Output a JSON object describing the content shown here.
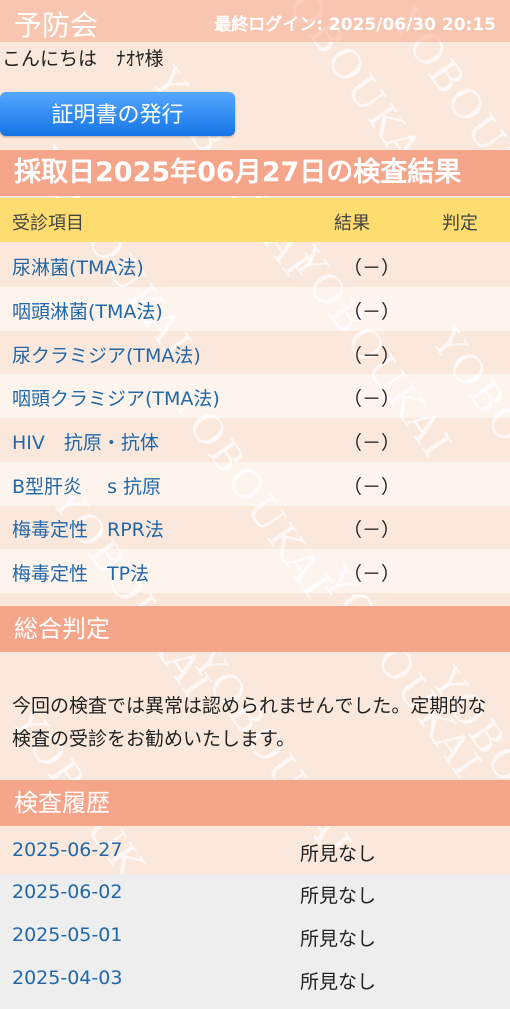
{
  "header": {
    "brand": "予防会",
    "last_login": "最終ログイン: 2025/06/30 20:15"
  },
  "greeting": "こんにちは　ﾅｵﾔ様",
  "certificate_button": "証明書の発行",
  "results": {
    "title": "採取日2025年06月27日の検査結果",
    "columns": {
      "item": "受診項目",
      "result": "結果",
      "judgment": "判定"
    },
    "rows": [
      {
        "item": "尿淋菌(TMA法)",
        "result": "（－）"
      },
      {
        "item": "咽頭淋菌(TMA法)",
        "result": "（－）"
      },
      {
        "item": "尿クラミジア(TMA法)",
        "result": "（－）"
      },
      {
        "item": "咽頭クラミジア(TMA法)",
        "result": "（－）"
      },
      {
        "item": "HIV　抗原・抗体",
        "result": "（－）"
      },
      {
        "item": "B型肝炎　 s 抗原",
        "result": "（－）"
      },
      {
        "item": "梅毒定性　RPR法",
        "result": "（－）"
      },
      {
        "item": "梅毒定性　TP法",
        "result": "（－）"
      }
    ]
  },
  "overall": {
    "heading": "総合判定",
    "text": "今回の検査では異常は認められませんでした。定期的な検査の受診をお勧めいたします。"
  },
  "history": {
    "heading": "検査履歴",
    "rows": [
      {
        "date": "2025-06-27",
        "finding": "所見なし"
      },
      {
        "date": "2025-06-02",
        "finding": "所見なし"
      },
      {
        "date": "2025-05-01",
        "finding": "所見なし"
      },
      {
        "date": "2025-04-03",
        "finding": "所見なし"
      }
    ]
  },
  "watermark": "YOBOUKAI"
}
